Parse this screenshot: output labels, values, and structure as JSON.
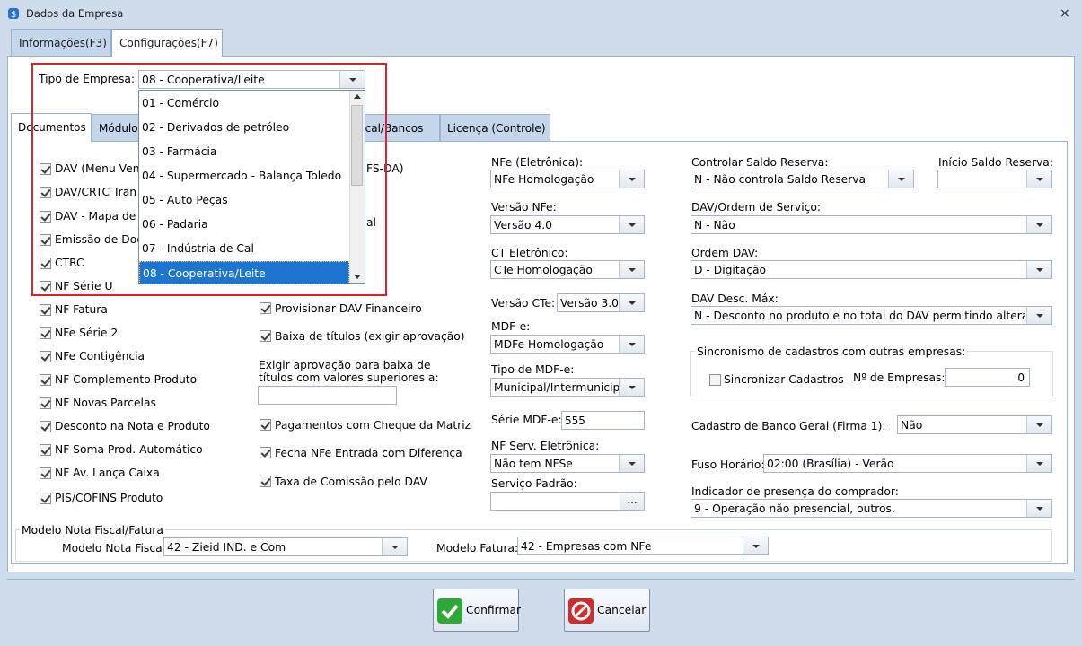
{
  "window": {
    "title": "Dados da Empresa",
    "close": "×"
  },
  "tabs": [
    {
      "label": "Informações(F3)"
    },
    {
      "label": "Configurações(F7)"
    }
  ],
  "tipo_empresa": {
    "label": "Tipo de Empresa:",
    "value": "08 - Cooperativa/Leite",
    "options": [
      "01 - Comércio",
      "02 - Derivados de petróleo",
      "03 - Farmácia",
      "04 - Supermercado - Balança Toledo",
      "05 - Auto Peças",
      "06 - Padaria",
      "07 - Indústria de Cal",
      "08 - Cooperativa/Leite"
    ]
  },
  "inner_tabs": [
    {
      "label": "Documentos"
    },
    {
      "label": "Módulos"
    },
    {
      "label": "Fiscal/Bancos"
    },
    {
      "label": "Licença (Controle)"
    }
  ],
  "col1": [
    {
      "label": "DAV (Menu Venda)",
      "checked": true
    },
    {
      "label": "DAV/CRTC Transporte",
      "checked": true
    },
    {
      "label": "DAV - Mapa de Entrega",
      "checked": true
    },
    {
      "label": "Emissão de Documento",
      "checked": true
    },
    {
      "label": "CTRC",
      "checked": true
    },
    {
      "label": "NF Série U",
      "checked": true
    },
    {
      "label": "NF Fatura",
      "checked": true
    },
    {
      "label": "NFe Série 2",
      "checked": true
    },
    {
      "label": "NFe Contigência",
      "checked": true
    },
    {
      "label": "NF Complemento Produto",
      "checked": true
    },
    {
      "label": "NF Novas Parcelas",
      "checked": true
    },
    {
      "label": "Desconto na Nota e Produto",
      "checked": true
    },
    {
      "label": "NF Soma Prod. Automático",
      "checked": true
    },
    {
      "label": "NF Av. Lança Caixa",
      "checked": true
    },
    {
      "label": "PIS/COFINS Produto",
      "checked": true
    }
  ],
  "col1_visible_labels": [
    "DAV (Menu Vend",
    "DAV/CRTC Tran",
    "DAV - Mapa de E",
    "Emissão de Docu",
    "CTRC",
    "NF Série U",
    "NF Fatura",
    "NFe Série 2",
    "NFe Contigência",
    "NF Complemento Produto",
    "NF Novas Parcelas",
    "Desconto na Nota e Produto",
    "NF Soma Prod. Automático",
    "NF Av. Lança Caixa",
    "PIS/COFINS Produto"
  ],
  "col2": {
    "hidden_fragments": [
      "FS-DA)",
      "al"
    ],
    "provisionar": "Provisionar DAV Financeiro",
    "baixa": "Baixa de títulos (exigir aprovação)",
    "exigir_label_1": "Exigir aprovação para baixa de",
    "exigir_label_2": "títulos com valores superiores a:",
    "exigir_value": "",
    "cheque": "Pagamentos com Cheque da Matriz",
    "fecha": "Fecha NFe Entrada com Diferença",
    "comissao": "Taxa de Comissão pelo DAV"
  },
  "col3": {
    "nfe_label": "NFe (Eletrônica):",
    "nfe_value": "NFe Homologação",
    "versao_nfe_label": "Versão NFe:",
    "versao_nfe_value": "Versão 4.0",
    "cte_label": "CT Eletrônico:",
    "cte_value": "CTe Homologação",
    "versao_cte_label": "Versão CTe:",
    "versao_cte_value": "Versão 3.0",
    "mdfe_label": "MDF-e:",
    "mdfe_value": "MDFe Homologação",
    "tipo_mdfe_label": "Tipo de MDF-e:",
    "tipo_mdfe_value": "Municipal/Intermunicipal",
    "serie_mdfe_label": "Série MDF-e:",
    "serie_mdfe_value": "555",
    "nfse_label": "NF Serv. Eletrônica:",
    "nfse_value": "Não tem NFSe",
    "servico_label": "Serviço Padrão:",
    "servico_value": "",
    "servico_btn": "..."
  },
  "col4": {
    "saldo_label": "Controlar Saldo Reserva:",
    "saldo_value": "N - Não controla Saldo Reserva",
    "inicio_label": "Início Saldo Reserva:",
    "inicio_value": "",
    "os_label": "DAV/Ordem de Serviço:",
    "os_value": "N - Não",
    "ordem_label": "Ordem DAV:",
    "ordem_value": "D - Digitação",
    "desc_label": "DAV Desc. Máx:",
    "desc_value": "N - Desconto no produto e no total do DAV permitindo alterar o v",
    "sinc_group": "Sincronismo de cadastros com outras empresas:",
    "sinc_label": "Sincronizar Cadastros",
    "sinc_checked": false,
    "nemp_label": "Nº de Empresas:",
    "nemp_value": "0",
    "banco_label": "Cadastro de Banco Geral (Firma 1):",
    "banco_value": "Não",
    "fuso_label": "Fuso Horário:",
    "fuso_value": "02:00 (Brasília) - Verão",
    "presenca_label": "Indicador de presença do comprador:",
    "presenca_value": "9 - Operação não presencial, outros."
  },
  "modelo": {
    "group": "Modelo Nota Fiscal/Fatura",
    "nf_label": "Modelo Nota Fiscal:",
    "nf_value": "42 - Zieid IND. e Com",
    "fatura_label": "Modelo Fatura:",
    "fatura_value": "42 - Empresas com NFe"
  },
  "buttons": {
    "confirmar": "Confirmar",
    "cancelar": "Cancelar"
  },
  "colors": {
    "highlight": "#e0202a",
    "selection": "#1e75d0",
    "window_bg": "#cfdcec"
  }
}
